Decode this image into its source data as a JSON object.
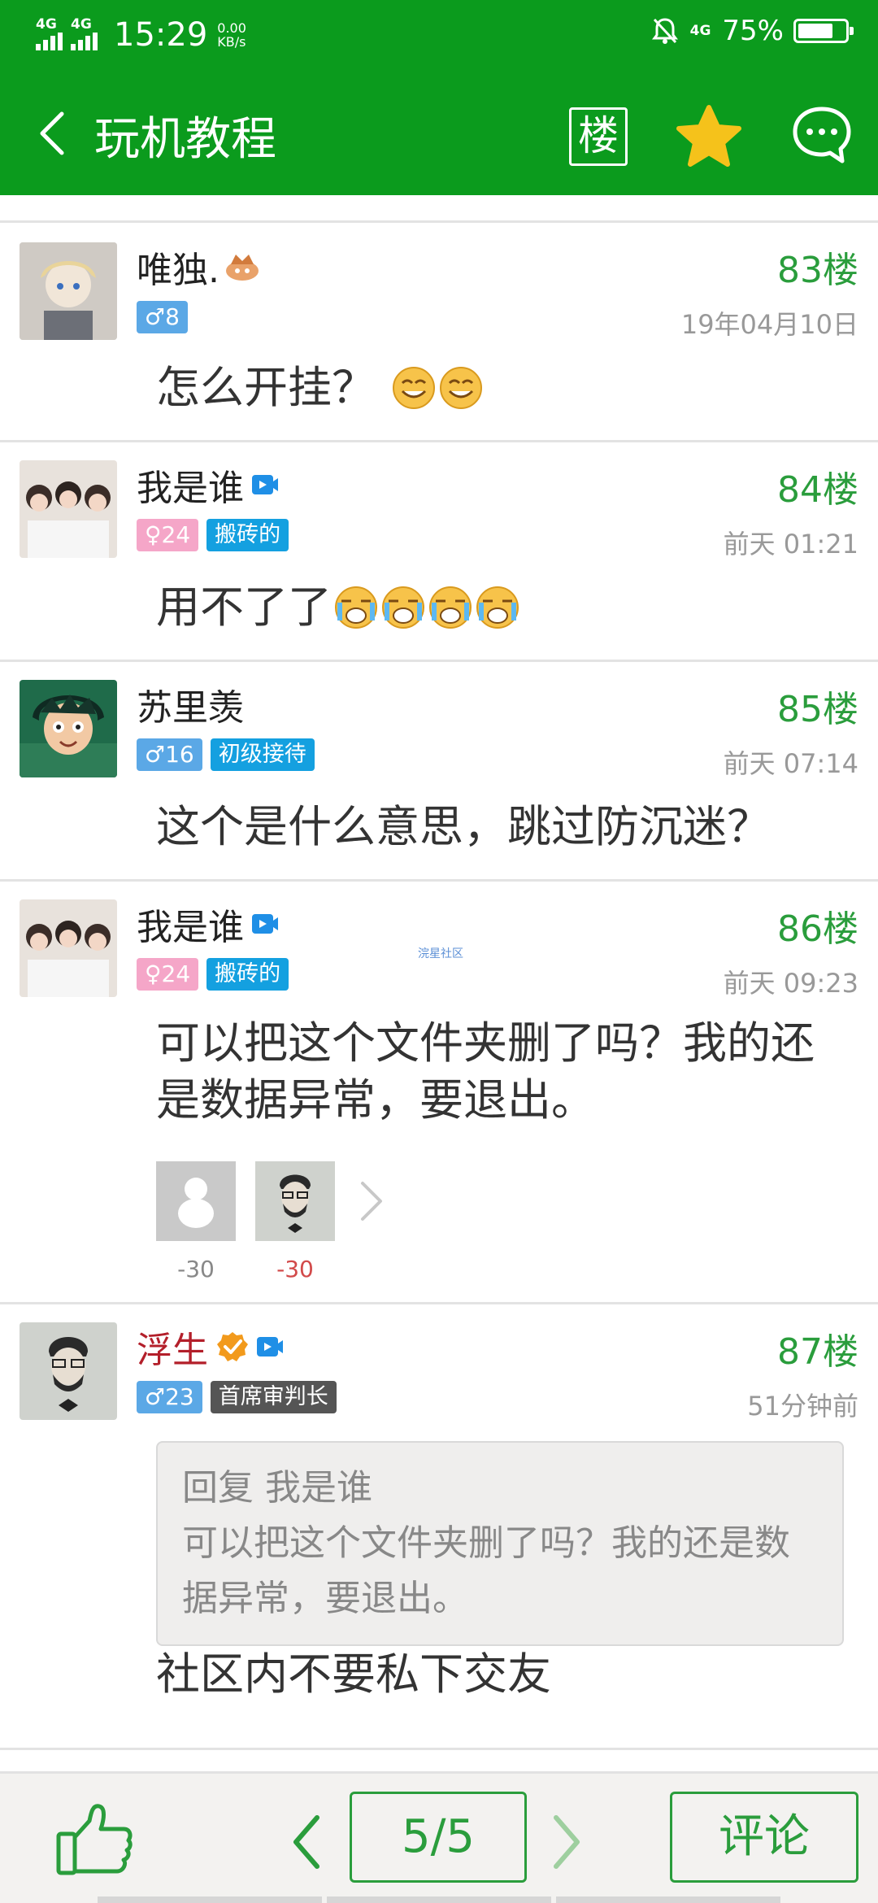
{
  "status_bar": {
    "signal1": "4G",
    "signal2": "4G",
    "time": "15:29",
    "speed_value": "0.00",
    "speed_unit": "KB/s",
    "network": "4G",
    "battery_text": "75%",
    "battery_level": 0.75
  },
  "header": {
    "title": "玩机教程",
    "floor_button": "楼",
    "icons": [
      "back-arrow-icon",
      "star-icon",
      "chat-bubble-icon"
    ]
  },
  "posts": [
    {
      "username": "唯独.",
      "gender": "male",
      "level": "♂8",
      "role": "",
      "floor": "83楼",
      "time": "19年04月10日",
      "content": "怎么开挂？"
    },
    {
      "username": "我是谁",
      "gender": "female",
      "level": "♀24",
      "role": "搬砖的",
      "floor": "84楼",
      "time": "前天 01:21",
      "content": "用不了了"
    },
    {
      "username": "苏里羡",
      "gender": "male",
      "level": "♂16",
      "role": "初级接待",
      "floor": "85楼",
      "time": "前天 07:14",
      "content": "这个是什么意思，跳过防沉迷？"
    },
    {
      "username": "我是谁",
      "gender": "female",
      "level": "♀24",
      "role": "搬砖的",
      "floor": "86楼",
      "time": "前天 09:23",
      "content": "可以把这个文件夹删了吗？我的还是数据异常，要退出。",
      "reactions": [
        "-30",
        "-30"
      ]
    },
    {
      "username": "浮生",
      "gender": "male",
      "level": "♂23",
      "role": "首席审判长",
      "floor": "87楼",
      "time": "51分钟前",
      "quote_title": "回复 我是谁",
      "quote_body": "可以把这个文件夹删了吗？我的还是数据异常，要退出。",
      "content": "社区内不要私下交友"
    }
  ],
  "watermark": "浣星社区",
  "bottom_bar": {
    "page": "5/5",
    "comment_label": "评论",
    "icons": [
      "thumbs-up-icon",
      "prev-page-icon",
      "next-page-icon"
    ]
  },
  "colors": {
    "brand_green": "#0b9b1d",
    "floor_green": "#2a9d3c",
    "male_badge": "#5ba8e6",
    "female_badge": "#f5a6c8",
    "role_blue": "#14a0e0",
    "role_dark": "#555555",
    "vip_name_red": "#b31f2a"
  }
}
